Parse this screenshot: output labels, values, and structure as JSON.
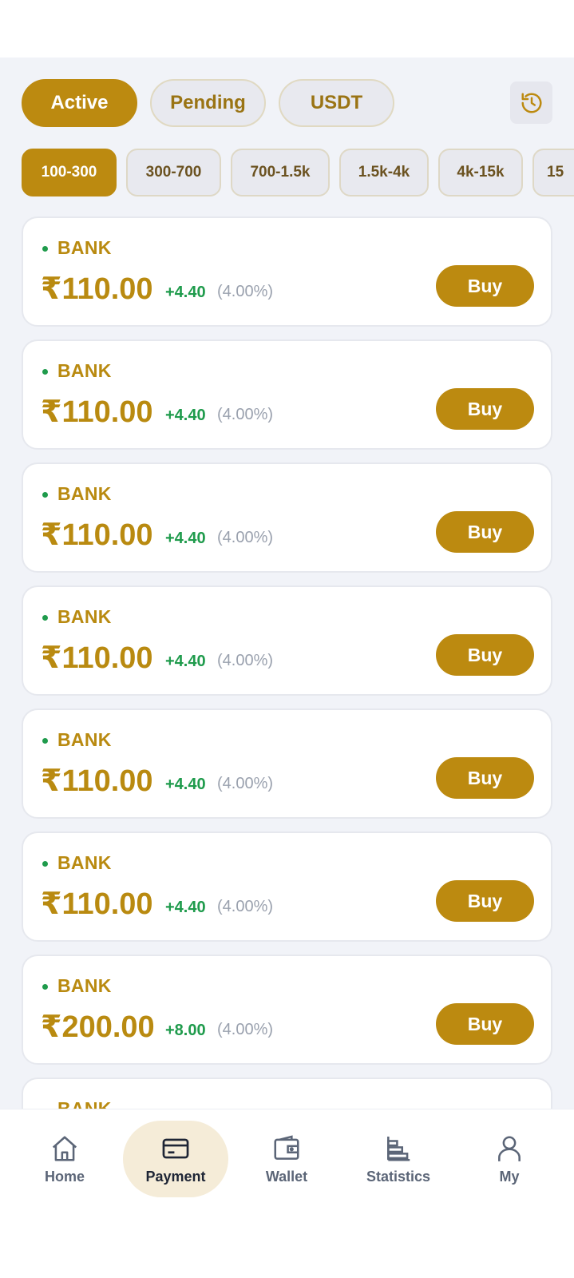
{
  "status_tabs": [
    {
      "label": "Active",
      "active": true
    },
    {
      "label": "Pending",
      "active": false
    },
    {
      "label": "USDT",
      "active": false
    }
  ],
  "history_icon": "history-icon",
  "range_tabs": [
    {
      "label": "100-300",
      "active": true
    },
    {
      "label": "300-700",
      "active": false
    },
    {
      "label": "700-1.5k",
      "active": false
    },
    {
      "label": "1.5k-4k",
      "active": false
    },
    {
      "label": "4k-15k",
      "active": false
    },
    {
      "label": "15",
      "active": false
    }
  ],
  "orders": [
    {
      "method": "BANK",
      "amount": "₹110.00",
      "bonus": "+4.40",
      "percent": "(4.00%)",
      "button": "Buy"
    },
    {
      "method": "BANK",
      "amount": "₹110.00",
      "bonus": "+4.40",
      "percent": "(4.00%)",
      "button": "Buy"
    },
    {
      "method": "BANK",
      "amount": "₹110.00",
      "bonus": "+4.40",
      "percent": "(4.00%)",
      "button": "Buy"
    },
    {
      "method": "BANK",
      "amount": "₹110.00",
      "bonus": "+4.40",
      "percent": "(4.00%)",
      "button": "Buy"
    },
    {
      "method": "BANK",
      "amount": "₹110.00",
      "bonus": "+4.40",
      "percent": "(4.00%)",
      "button": "Buy"
    },
    {
      "method": "BANK",
      "amount": "₹110.00",
      "bonus": "+4.40",
      "percent": "(4.00%)",
      "button": "Buy"
    },
    {
      "method": "BANK",
      "amount": "₹200.00",
      "bonus": "+8.00",
      "percent": "(4.00%)",
      "button": "Buy"
    },
    {
      "method": "BANK",
      "amount": "",
      "bonus": "",
      "percent": "",
      "button": ""
    }
  ],
  "nav": [
    {
      "label": "Home",
      "icon": "home-icon",
      "active": false
    },
    {
      "label": "Payment",
      "icon": "card-icon",
      "active": true
    },
    {
      "label": "Wallet",
      "icon": "wallet-icon",
      "active": false
    },
    {
      "label": "Statistics",
      "icon": "statistics-icon",
      "active": false
    },
    {
      "label": "My",
      "icon": "user-icon",
      "active": false
    }
  ],
  "colors": {
    "accent": "#bc8a10",
    "positive": "#1f9b4c",
    "muted": "#9aa1ae",
    "background": "#f1f3f8"
  }
}
